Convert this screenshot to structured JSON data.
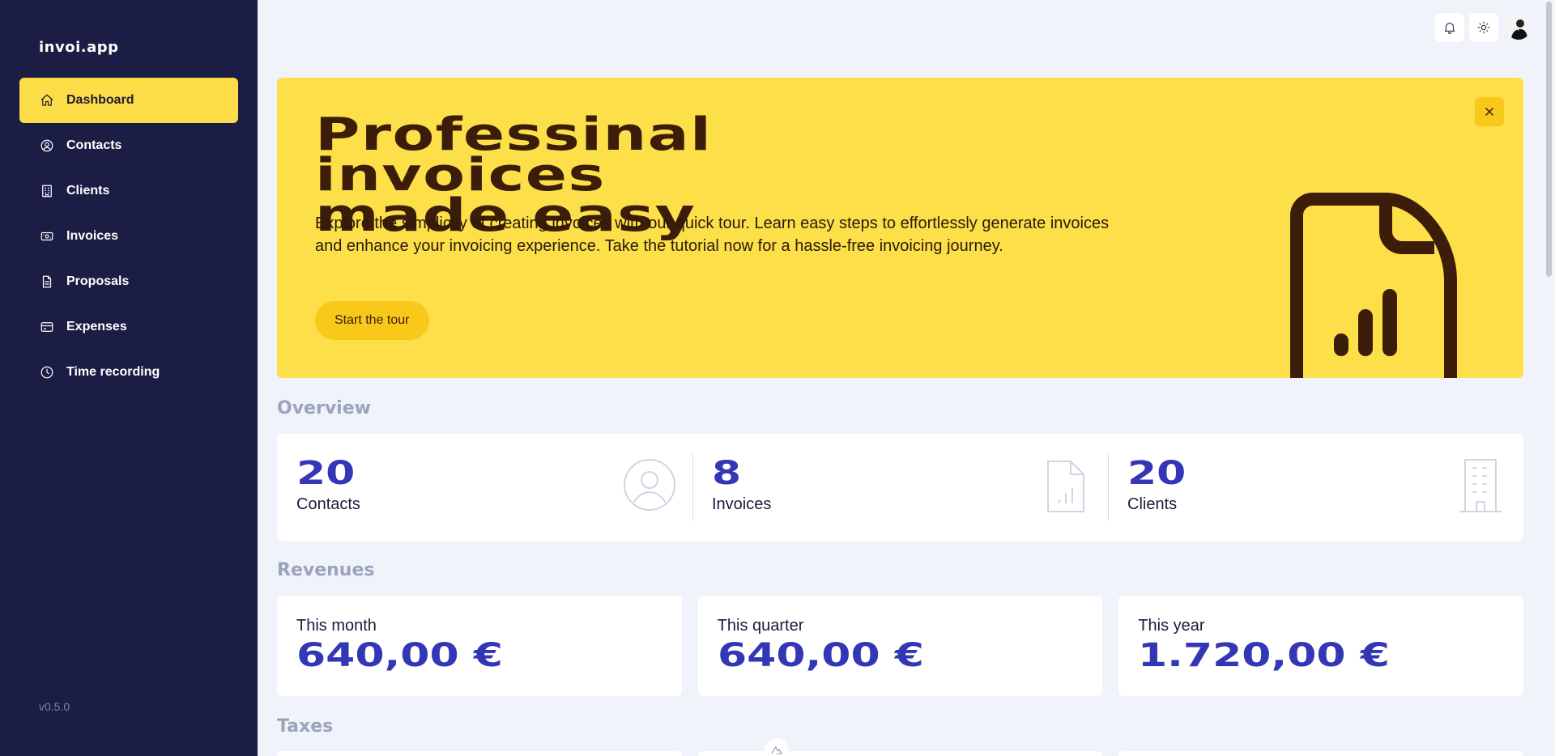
{
  "app": {
    "logo": "invoi.app",
    "version": "v0.5.0"
  },
  "sidebar": {
    "items": [
      {
        "label": "Dashboard",
        "icon": "home-icon",
        "active": true
      },
      {
        "label": "Contacts",
        "icon": "user-circle-icon"
      },
      {
        "label": "Clients",
        "icon": "building-icon"
      },
      {
        "label": "Invoices",
        "icon": "money-icon"
      },
      {
        "label": "Proposals",
        "icon": "document-icon"
      },
      {
        "label": "Expenses",
        "icon": "credit-card-icon"
      },
      {
        "label": "Time recording",
        "icon": "clock-icon"
      }
    ]
  },
  "topbar": {
    "icons": [
      "bell-icon",
      "sun-icon",
      "avatar"
    ]
  },
  "hero": {
    "title_line1": "Professinal invoices",
    "title_line2": "made easy",
    "text": "Explore the simplicity of creating invoices with our quick tour. Learn easy steps to effortlessly generate invoices and enhance your invoicing experience. Take the tutorial now for a hassle-free invoicing journey.",
    "button": "Start the tour",
    "close_icon": "close-icon"
  },
  "overview": {
    "title": "Overview",
    "stats": [
      {
        "value": "20",
        "label": "Contacts",
        "icon": "user-circle-icon"
      },
      {
        "value": "8",
        "label": "Invoices",
        "icon": "document-chart-icon"
      },
      {
        "value": "20",
        "label": "Clients",
        "icon": "building-icon"
      }
    ]
  },
  "revenues": {
    "title": "Revenues",
    "cards": [
      {
        "label": "This month",
        "value": "640,00 €"
      },
      {
        "label": "This quarter",
        "value": "640,00 €"
      },
      {
        "label": "This year",
        "value": "1.720,00 €"
      }
    ]
  },
  "taxes": {
    "title": "Taxes"
  },
  "colors": {
    "sidebar": "#1c1d45",
    "accent": "#fcdd47",
    "hero": "#fddf4a",
    "number": "#3337b6",
    "heading": "#9aa4bb"
  }
}
